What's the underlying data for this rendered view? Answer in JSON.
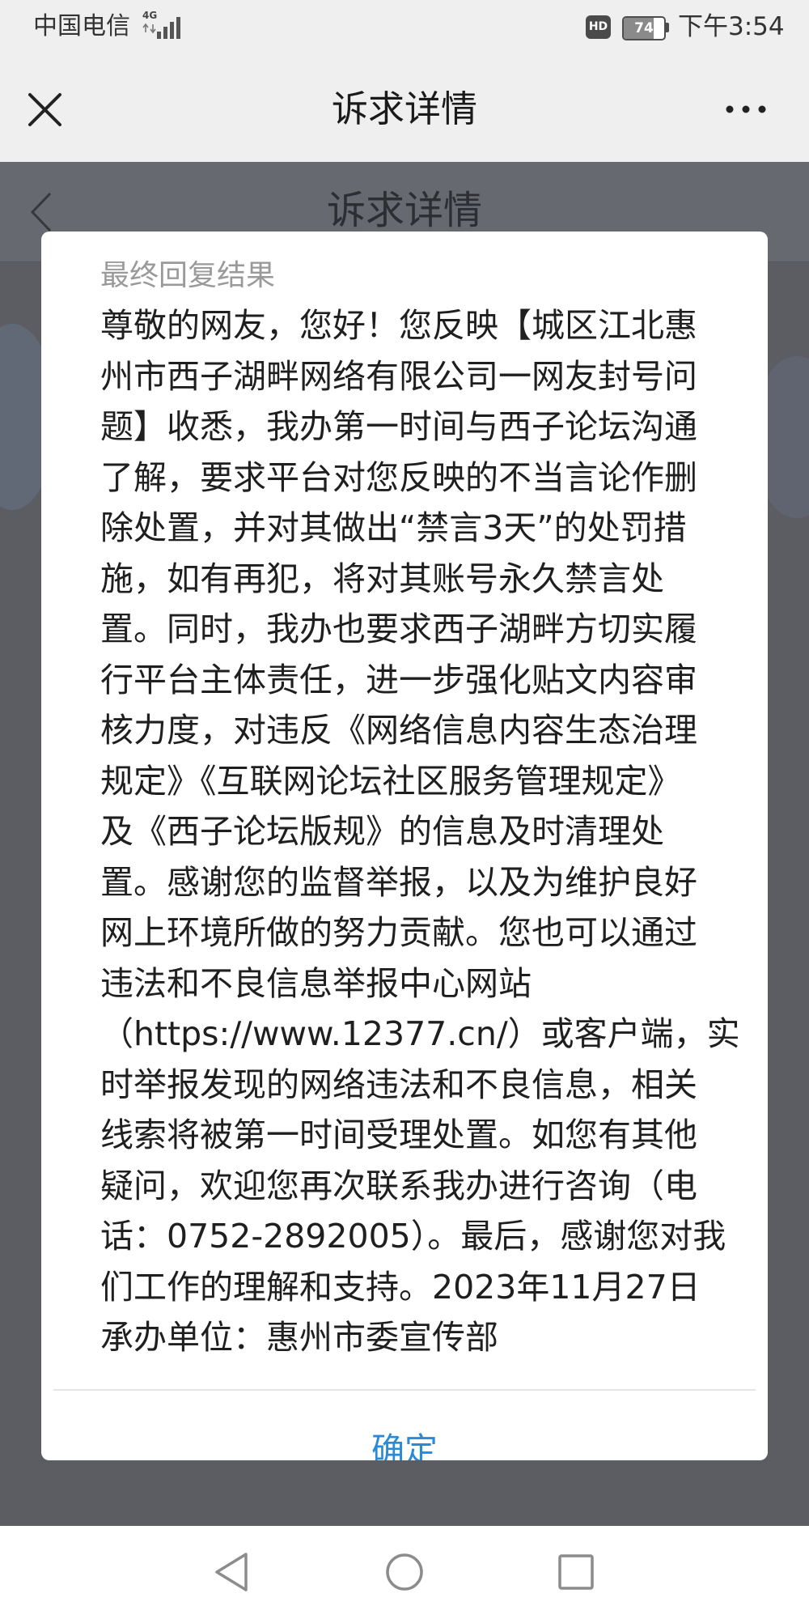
{
  "status_bar": {
    "carrier": "中国电信",
    "network_type": "4G",
    "signal_icon": "signal-icon",
    "hd_badge": "HD",
    "battery_level": "74",
    "battery_percent": 74,
    "time": "下午3:54"
  },
  "header": {
    "close_icon": "close-icon",
    "title": "诉求详情",
    "more_icon": "more-icon"
  },
  "background_page": {
    "back_icon": "chevron-left-icon",
    "title": "诉求详情"
  },
  "dialog": {
    "title": "最终回复结果",
    "body_lines": [
      "尊敬的网友，您好！您反映【城区江北惠",
      "州市西子湖畔网络有限公司一网友封号问",
      "题】收悉，我办第一时间与西子论坛沟通",
      "了解，要求平台对您反映的不当言论作删",
      "除处置，并对其做出“禁言3天”的处罚措",
      "施，如有再犯，将对其账号永久禁言处",
      "置。同时，我办也要求西子湖畔方切实履",
      "行平台主体责任，进一步强化贴文内容审",
      "核力度，对违反《网络信息内容生态治理",
      "规定》《互联网论坛社区服务管理规定》",
      "及《西子论坛版规》的信息及时清理处",
      "置。感谢您的监督举报，以及为维护良好",
      "网上环境所做的努力贡献。您也可以通过",
      "违法和不良信息举报中心网站",
      "（https://www.12377.cn/）或客户端，实",
      "时举报发现的网络违法和不良信息，相关",
      "线索将被第一时间受理处置。如您有其他",
      "疑问，欢迎您再次联系我办进行咨询（电",
      "话：0752-2892005）。最后，感谢您对我",
      "们工作的理解和支持。2023年11月27日",
      "承办单位：惠州市委宣传部"
    ],
    "confirm_label": "确定"
  },
  "nav_bar": {
    "back_icon": "back-triangle-icon",
    "home_icon": "home-circle-icon",
    "recents_icon": "recents-square-icon"
  },
  "colors": {
    "accent": "#2b8ad8",
    "overlay": "#5b5d63",
    "dialog_title": "#9a9a9a",
    "dialog_text": "#1f1f1f"
  }
}
